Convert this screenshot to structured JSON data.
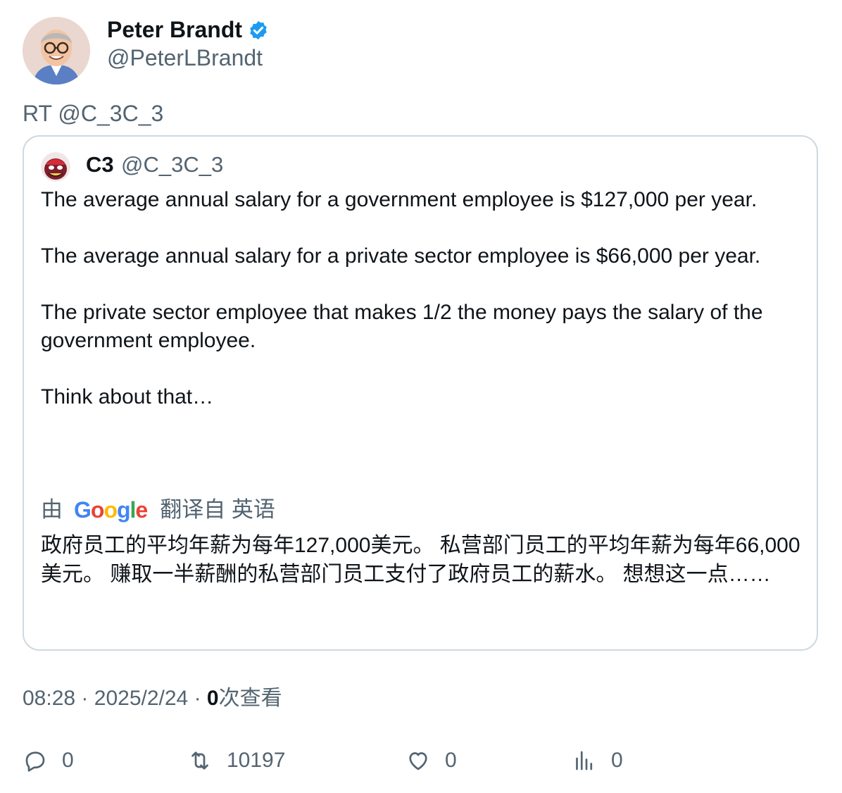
{
  "author": {
    "name": "Peter Brandt",
    "handle": "@PeterLBrandt",
    "verified_color": "#1d9bf0"
  },
  "retweet_line": "RT @C_3C_3",
  "quote": {
    "name": "C3",
    "handle": "@C_3C_3",
    "body": "The average annual salary for a government employee is $127,000 per year.\n\nThe average annual salary for a private sector employee is $66,000 per year.\n\nThe private sector employee that makes 1/2 the money pays the salary of the government employee.\n\nThink about that…",
    "translate": {
      "prefix": "由",
      "brand": "Google",
      "suffix": "翻译自 英语",
      "text": "政府员工的平均年薪为每年127,000美元。 私营部门员工的平均年薪为每年66,000美元。 赚取一半薪酬的私营部门员工支付了政府员工的薪水。 想想这一点……"
    }
  },
  "meta": {
    "time": "08:28",
    "separator": "·",
    "date": "2025/2/24",
    "views_count": "0",
    "views_label": "次查看"
  },
  "actions": {
    "reply_count": "0",
    "retweet_count": "10197",
    "like_count": "0",
    "views_count": "0"
  },
  "colors": {
    "text_primary": "#0f1419",
    "text_secondary": "#536471",
    "border": "#cfd9de",
    "accent": "#1d9bf0"
  }
}
